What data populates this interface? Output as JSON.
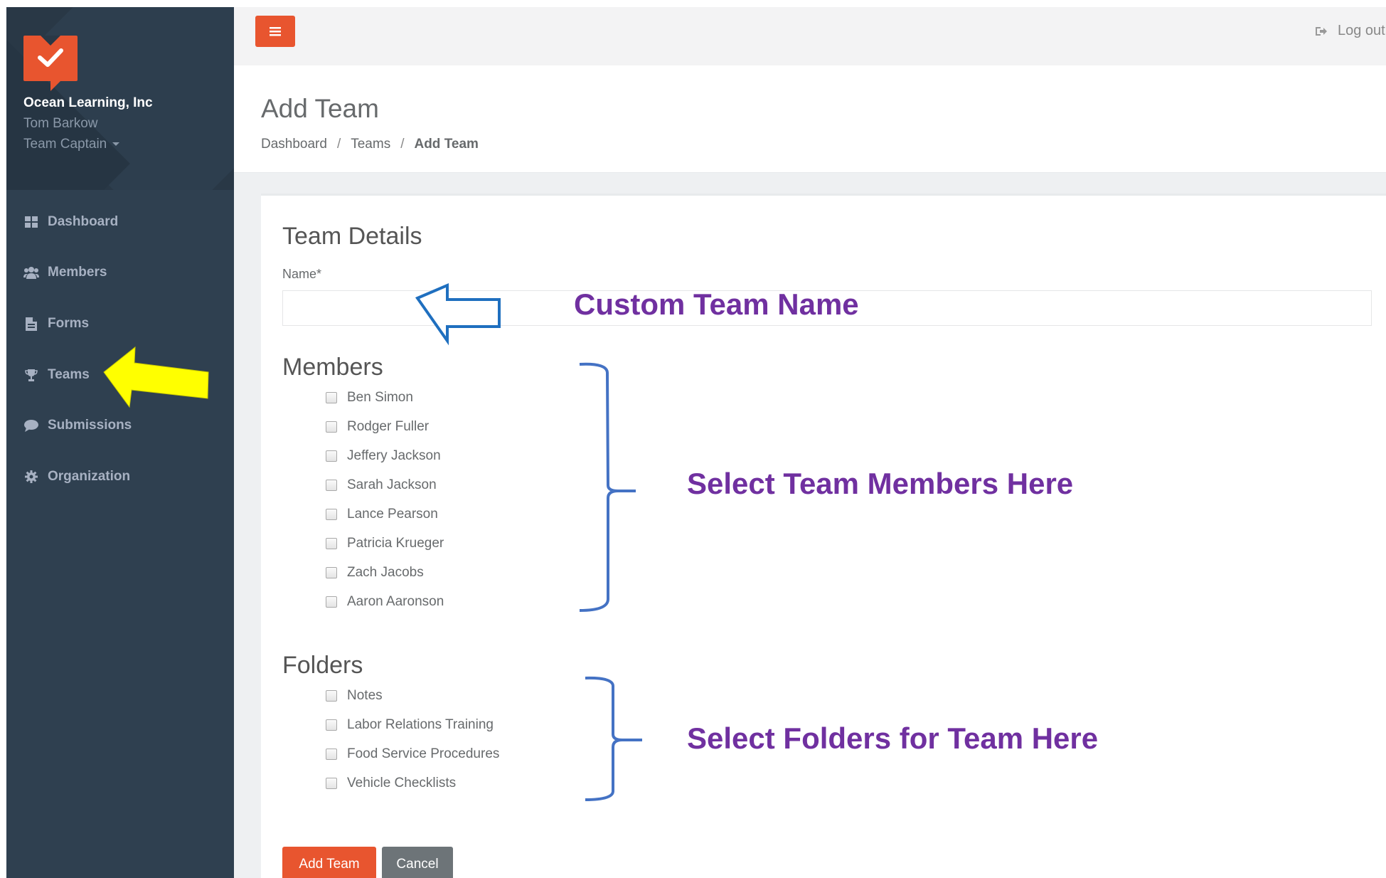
{
  "sidebar": {
    "org_name": "Ocean Learning, Inc",
    "user_name": "Tom Barkow",
    "user_role": "Team Captain",
    "nav": [
      {
        "label": "Dashboard",
        "icon": "dashboard-icon"
      },
      {
        "label": "Members",
        "icon": "users-icon"
      },
      {
        "label": "Forms",
        "icon": "file-icon"
      },
      {
        "label": "Teams",
        "icon": "trophy-icon"
      },
      {
        "label": "Submissions",
        "icon": "comment-icon"
      },
      {
        "label": "Organization",
        "icon": "gear-icon"
      }
    ]
  },
  "topbar": {
    "logout_label": "Log out"
  },
  "page": {
    "title": "Add Team",
    "breadcrumb": [
      "Dashboard",
      "Teams",
      "Add Team"
    ]
  },
  "form": {
    "section_title": "Team Details",
    "name_label": "Name*",
    "name_value": "",
    "members_title": "Members",
    "members": [
      "Ben Simon",
      "Rodger Fuller",
      "Jeffery Jackson",
      "Sarah Jackson",
      "Lance Pearson",
      "Patricia Krueger",
      "Zach Jacobs",
      "Aaron Aaronson"
    ],
    "folders_title": "Folders",
    "folders": [
      "Notes",
      "Labor Relations Training",
      "Food Service Procedures",
      "Vehicle Checklists"
    ],
    "submit_label": "Add Team",
    "cancel_label": "Cancel"
  },
  "annotations": {
    "name_note": "Custom Team Name",
    "members_note": "Select Team Members Here",
    "folders_note": "Select Folders for Team Here"
  },
  "colors": {
    "accent": "#e8552f",
    "sidebar_bg": "#2f4050",
    "annotation_text": "#7030a0",
    "annotation_arrow_yellow": "#ffff00",
    "annotation_bracket": "#4472c4"
  }
}
